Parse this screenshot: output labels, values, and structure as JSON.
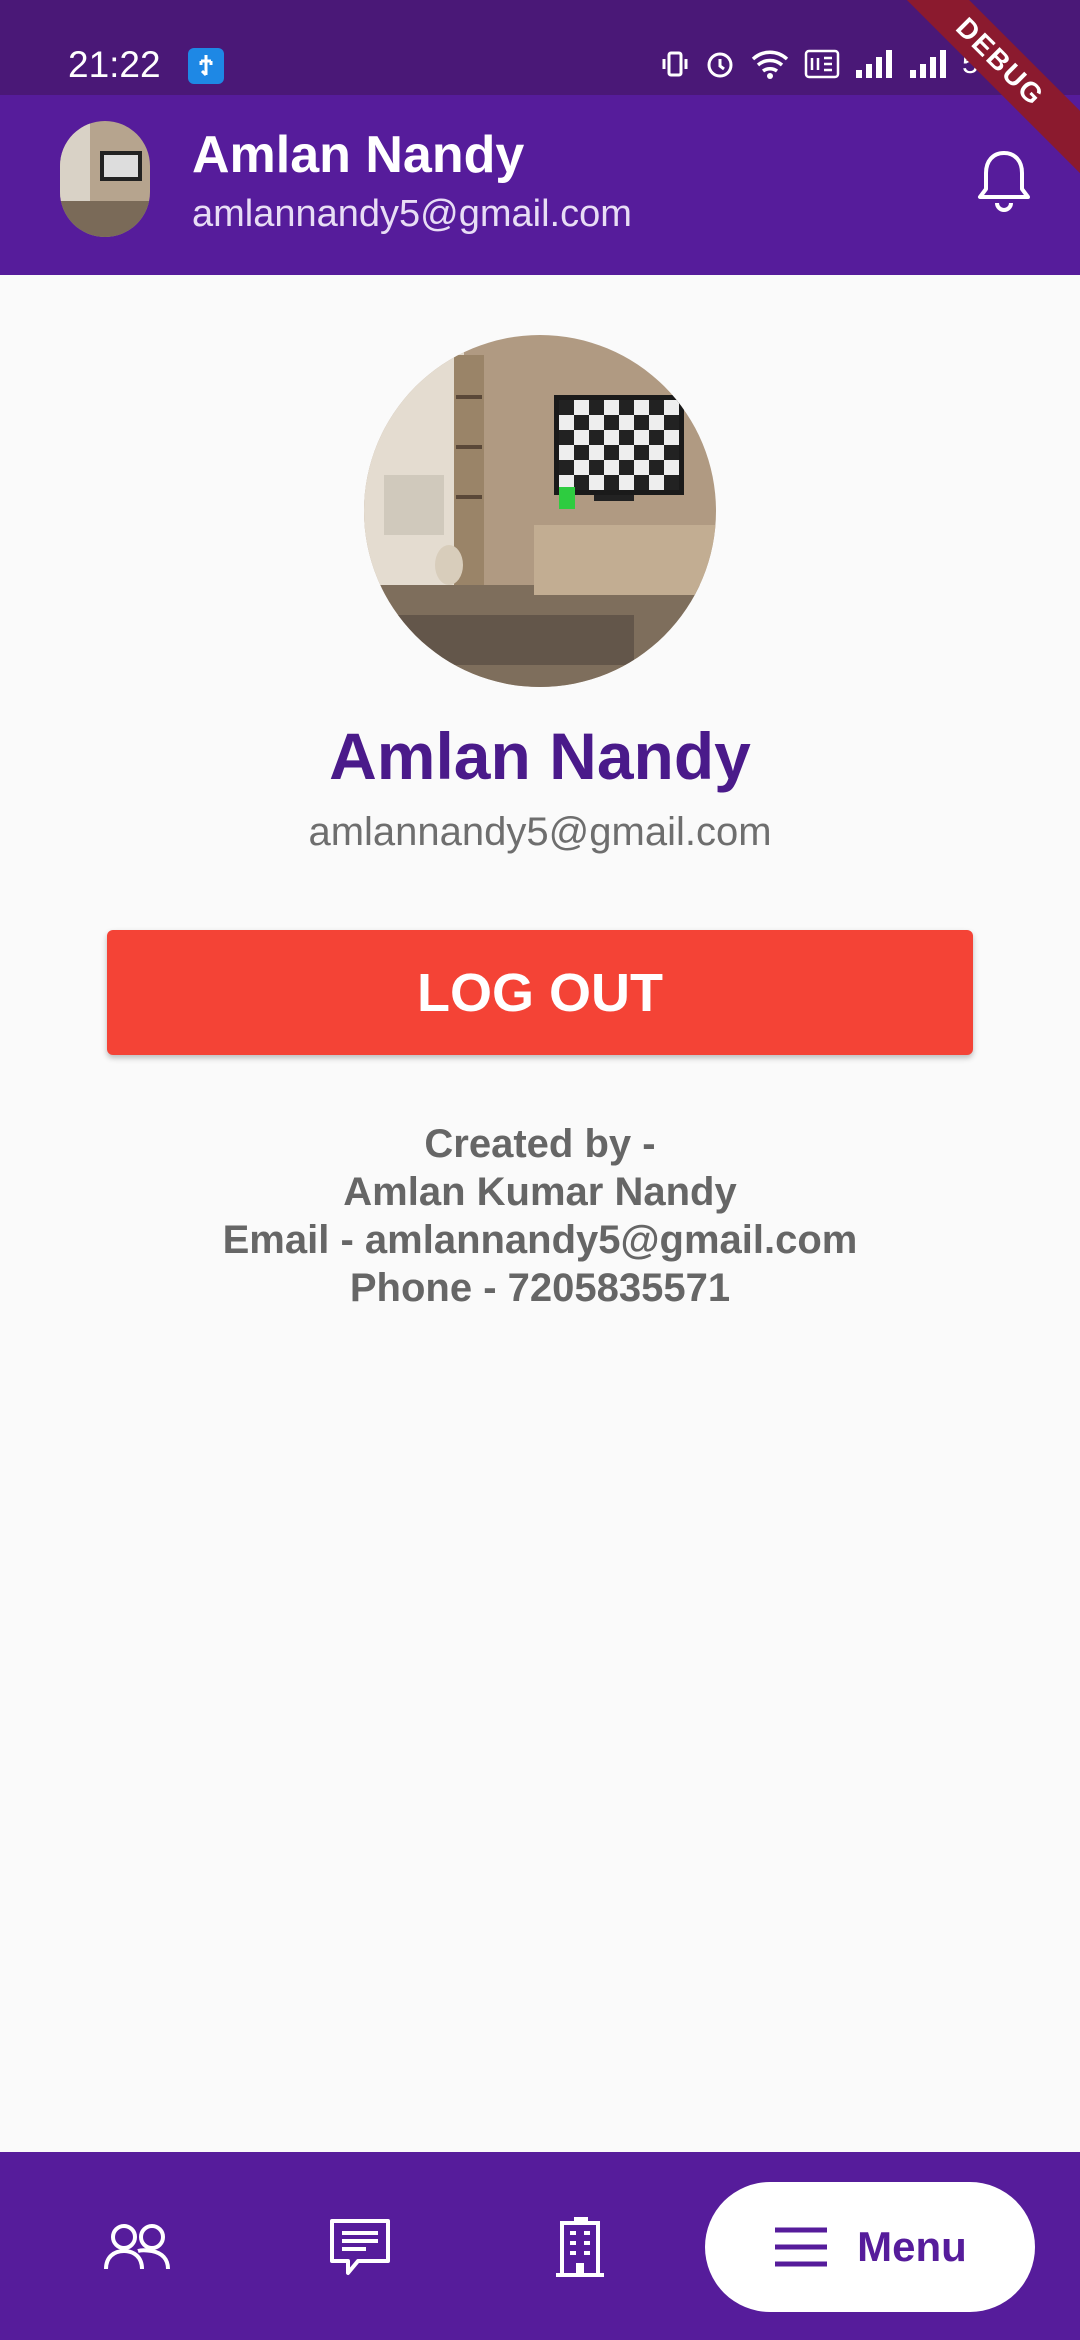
{
  "status_bar": {
    "time": "21:22",
    "battery": "55%"
  },
  "debug_banner": "DEBUG",
  "app_bar": {
    "user_name": "Amlan Nandy",
    "user_email": "amlannandy5@gmail.com"
  },
  "profile": {
    "name": "Amlan Nandy",
    "email": "amlannandy5@gmail.com",
    "logout_label": "LOG OUT"
  },
  "credits": {
    "line1": "Created by -",
    "line2": "Amlan Kumar Nandy",
    "line3": "Email - amlannandy5@gmail.com",
    "line4": "Phone - 7205835571"
  },
  "bottom_nav": {
    "menu_label": "Menu"
  },
  "colors": {
    "primary": "#561c9b",
    "logout": "#f44336"
  }
}
